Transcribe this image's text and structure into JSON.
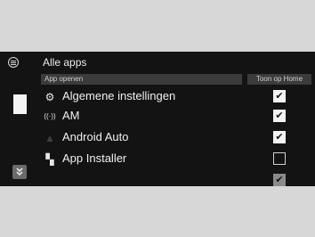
{
  "header": {
    "title": "Alle apps",
    "menu_icon": "list-circle-icon"
  },
  "columns": {
    "app": "App openen",
    "home": "Toon op Home"
  },
  "apps": [
    {
      "label": "Algemene instellingen",
      "icon": "gear-icon",
      "glyph": "⚙",
      "checked": true,
      "faded": false
    },
    {
      "label": "AM",
      "icon": "radio-antenna-icon",
      "glyph": "((·))",
      "checked": true,
      "faded": false
    },
    {
      "label": "Android Auto",
      "icon": "android-auto-icon",
      "glyph": "▲",
      "checked": true,
      "faded": false
    },
    {
      "label": "App Installer",
      "icon": "app-installer-icon",
      "glyph": "▚",
      "checked": false,
      "faded": false
    },
    {
      "label": "",
      "icon": "app-icon",
      "glyph": "",
      "checked": true,
      "faded": true
    }
  ],
  "scroll_icon": "scroll-down-icon",
  "colors": {
    "screen_bg": "#131313",
    "frame_bg": "#d7d7d7",
    "header_bar": "#3b3b3b"
  }
}
